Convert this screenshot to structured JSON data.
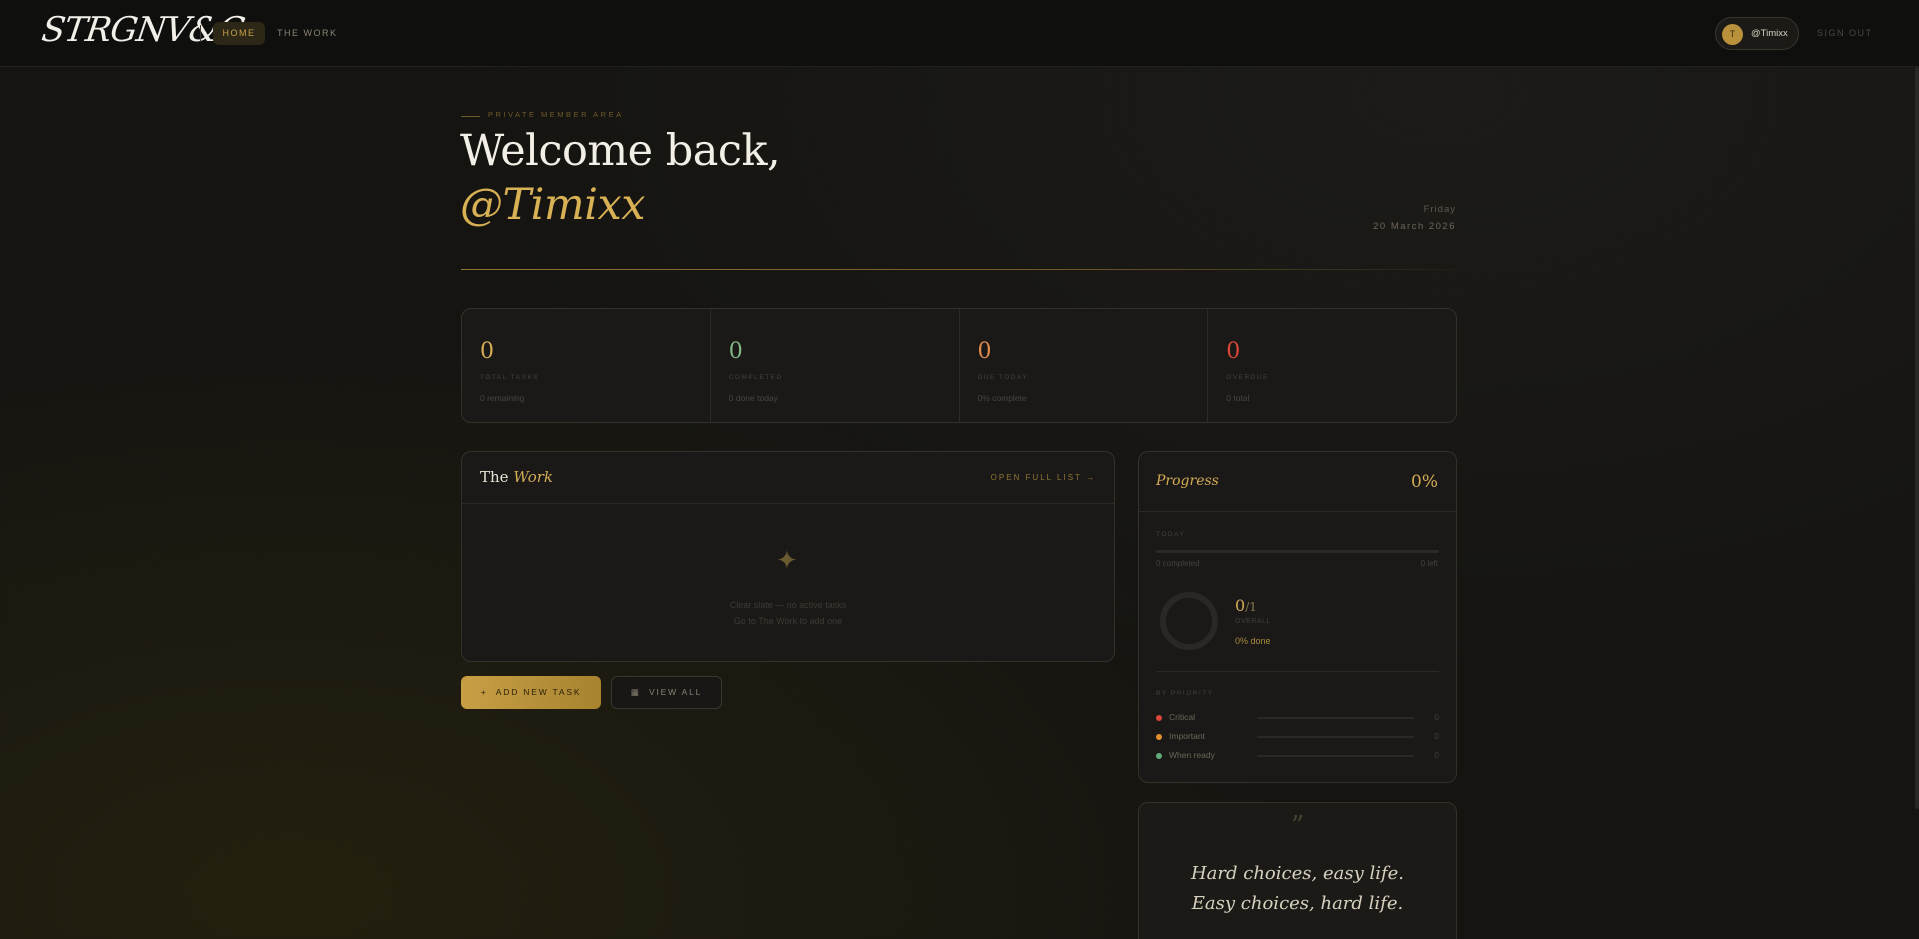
{
  "nav": {
    "logo": "STRGNV&Co",
    "home_label": "HOME",
    "work_label": "THE WORK",
    "user_initial": "T",
    "user_handle": "@Timixx",
    "signout_label": "SIGN OUT"
  },
  "hero": {
    "eyebrow": "PRIVATE MEMBER AREA",
    "welcome": "Welcome back,",
    "handle": "@Timixx",
    "day": "Friday",
    "date": "20 March 2026"
  },
  "stats": [
    {
      "value": "0",
      "label": "TOTAL TASKS",
      "sub": "0 remaining",
      "color": "#d4ac54"
    },
    {
      "value": "0",
      "label": "COMPLETED",
      "sub": "0 done today",
      "color": "#7fb885"
    },
    {
      "value": "0",
      "label": "DUE TODAY",
      "sub": "0% complete",
      "color": "#e08a4a"
    },
    {
      "value": "0",
      "label": "OVERDUE",
      "sub": "0 total",
      "color": "#d9463a"
    }
  ],
  "work": {
    "title_prefix": "The ",
    "title_em": "Work",
    "open_link": "OPEN FULL LIST →",
    "sparkle_icon": "✦",
    "empty_line1": "Clear slate — no active tasks",
    "empty_line2": "Go to The Work to add one"
  },
  "actions": {
    "add_label": "ADD NEW TASK",
    "add_icon": "+",
    "view_label": "VIEW ALL",
    "view_icon": "▦"
  },
  "progress": {
    "title": "Progress",
    "percent": "0%",
    "percent_value": 0,
    "today_label": "TODAY",
    "today_left": "0 completed",
    "today_right": "0 left",
    "ring_done": "0",
    "ring_total": "1",
    "ring_label": "OVERALL",
    "ring_pct": "0% done",
    "priority_label": "BY PRIORITY",
    "priorities": [
      {
        "name": "Critical",
        "count": "0",
        "color": "#d9463a"
      },
      {
        "name": "Important",
        "count": "0",
        "color": "#e0902e"
      },
      {
        "name": "When ready",
        "count": "0",
        "color": "#5fae7a"
      }
    ]
  },
  "quote": {
    "mark": "”",
    "line1": "Hard choices, easy life.",
    "line2": "Easy choices, hard life."
  }
}
